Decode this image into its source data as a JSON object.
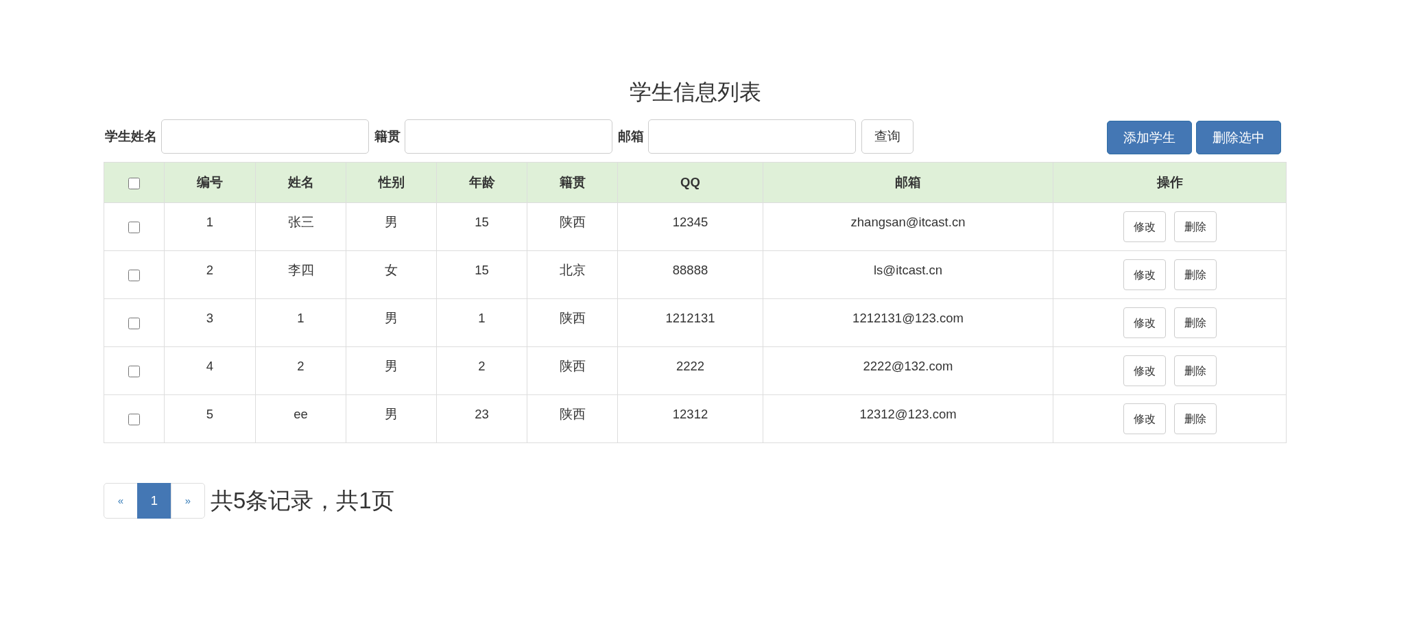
{
  "title": "学生信息列表",
  "search": {
    "fields": [
      {
        "label": "学生姓名"
      },
      {
        "label": "籍贯"
      },
      {
        "label": "邮箱"
      }
    ],
    "button": "查询"
  },
  "actions": [
    "添加学生",
    "删除选中"
  ],
  "table": {
    "select_all": {
      "checked": false
    },
    "columns": [
      "编号",
      "姓名",
      "性别",
      "年龄",
      "籍贯",
      "QQ",
      "邮箱",
      "操作"
    ],
    "rows": [
      {
        "checked": false,
        "cells": [
          "1",
          "张三",
          "男",
          "15",
          "陕西",
          "12345",
          "zhangsan@itcast.cn"
        ],
        "buttons": [
          "修改",
          "删除"
        ]
      },
      {
        "checked": false,
        "cells": [
          "2",
          "李四",
          "女",
          "15",
          "北京",
          "88888",
          "ls@itcast.cn"
        ],
        "buttons": [
          "修改",
          "删除"
        ]
      },
      {
        "checked": false,
        "cells": [
          "3",
          "1",
          "男",
          "1",
          "陕西",
          "1212131",
          "1212131@123.com"
        ],
        "buttons": [
          "修改",
          "删除"
        ]
      },
      {
        "checked": false,
        "cells": [
          "4",
          "2",
          "男",
          "2",
          "陕西",
          "2222",
          "2222@132.com"
        ],
        "buttons": [
          "修改",
          "删除"
        ]
      },
      {
        "checked": false,
        "cells": [
          "5",
          "ee",
          "男",
          "23",
          "陕西",
          "12312",
          "12312@123.com"
        ],
        "buttons": [
          "修改",
          "删除"
        ]
      }
    ]
  },
  "pagination": {
    "pages": [
      {
        "label": "«",
        "kind": "prev",
        "selected": false
      },
      {
        "label": "1",
        "kind": "page",
        "selected": true
      },
      {
        "label": "»",
        "kind": "next",
        "selected": false
      }
    ],
    "summary": "共5条记录，共1页"
  }
}
